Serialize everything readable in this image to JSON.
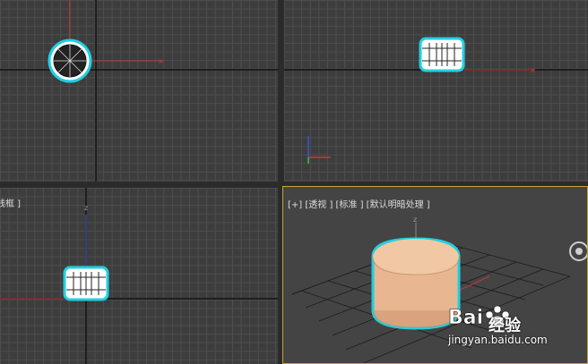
{
  "viewports": {
    "top": {
      "label": ""
    },
    "front": {
      "label": ""
    },
    "left": {
      "label": "线框 ]",
      "axis_label": "z"
    },
    "perspective": {
      "label": "[+] [透视 ] [标准 ] [默认明暗处理 ]",
      "axis_label": "z"
    }
  },
  "watermark": {
    "brand": "经验",
    "url": "jingyan.baidu.com"
  },
  "colors": {
    "grid": "#4e4e4e",
    "grid_axis": "#111111",
    "x_axis": "#c0393b",
    "selection": "#1fd0e0",
    "cylinder": "#e8b792",
    "active_border": "#c9a23a"
  }
}
